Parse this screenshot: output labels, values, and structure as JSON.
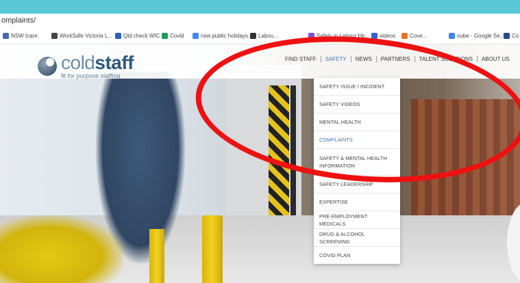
{
  "browser": {
    "url_fragment": "omplaints/",
    "bookmarks": [
      {
        "label": "NSW Icare",
        "icon": "arrow-icon",
        "color": "#4a6aa8"
      },
      {
        "label": "WorkSafe Victoria L...",
        "icon": "globe-icon",
        "color": "#444444"
      },
      {
        "label": "Qld check WIC",
        "icon": "w-icon",
        "color": "#2a62b8"
      },
      {
        "label": "Covid",
        "icon": "sheet-icon",
        "color": "#1e9d5a"
      },
      {
        "label": "nsw public holidays...",
        "icon": "g-icon",
        "color": "#4285f4"
      },
      {
        "label": "Labou...",
        "icon": "a-icon",
        "color": "#333333"
      },
      {
        "label": "Safety in Labour Hir...",
        "icon": "circle-icon",
        "color": "#8a4cd8"
      },
      {
        "label": "videos",
        "icon": "video-icon",
        "color": "#3a5fd8"
      },
      {
        "label": "Cove...",
        "icon": "dot-icon",
        "color": "#e8742a"
      },
      {
        "label": "oube - Google Se...",
        "icon": "g-icon",
        "color": "#4285f4"
      },
      {
        "label": "Co",
        "icon": "ds-icon",
        "color": "#2c4a8a"
      }
    ]
  },
  "site": {
    "logo_bold": "cold",
    "logo_accent": "staff",
    "tagline": "fit for purpose staffing"
  },
  "nav": [
    {
      "label": "FIND STAFF",
      "active": false
    },
    {
      "label": "SAFETY",
      "active": true
    },
    {
      "label": "NEWS",
      "active": false
    },
    {
      "label": "PARTNERS",
      "active": false
    },
    {
      "label": "TALENT SOLUTIONS",
      "active": false
    },
    {
      "label": "ABOUT US",
      "active": false
    }
  ],
  "safety_menu": [
    {
      "label": "SAFETY ISSUE / INCIDENT",
      "active": false
    },
    {
      "label": "SAFETY VIDEOS",
      "active": false
    },
    {
      "label": "MENTAL HEALTH",
      "active": false
    },
    {
      "label": "COMPLAINTS",
      "active": true
    },
    {
      "label": "SAFETY & MENTAL HEALTH INFORMATION",
      "active": false
    },
    {
      "label": "SAFETY LEADERSHIP",
      "active": false
    },
    {
      "label": "EXPERTISE",
      "active": false
    },
    {
      "label": "PRE-EMPLOYMENT MEDICALS",
      "active": false
    },
    {
      "label": "DRUG & ALCOHOL SCREENING",
      "active": false
    },
    {
      "label": "COVID PLAN",
      "active": false
    }
  ],
  "annotation": {
    "color": "#ee1111"
  }
}
